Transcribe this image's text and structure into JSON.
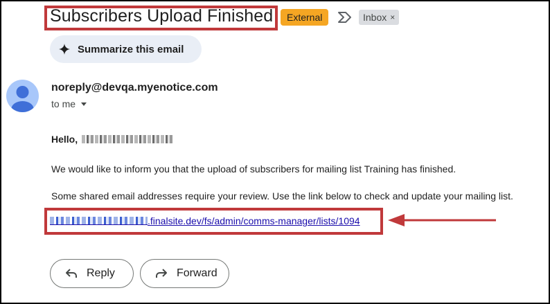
{
  "subject": "Subscribers Upload Finished",
  "badges": {
    "external": "External",
    "inbox": "Inbox",
    "inbox_close": "×"
  },
  "summarize_label": "Summarize this email",
  "sender": {
    "email": "noreply@devqa.myenotice.com",
    "to_label": "to me"
  },
  "body": {
    "greeting": "Hello,",
    "paragraph1": "We would like to inform you that the upload of subscribers for mailing list Training has finished.",
    "paragraph2": "Some shared email addresses require your review. Use the link below to check and update your mailing list.",
    "link_text": ".finalsite.dev/fs/admin/comms-manager/lists/1094"
  },
  "actions": {
    "reply": "Reply",
    "forward": "Forward"
  },
  "colors": {
    "annotation_red": "#c0393b",
    "external_badge": "#f5a623",
    "link": "#1a0dab",
    "summarize_bg": "#e9eef6",
    "avatar": "#a8c7fa"
  },
  "icons": [
    "sparkle-icon",
    "label-icon",
    "close-icon",
    "avatar-icon",
    "chevron-down-icon",
    "reply-icon",
    "forward-icon",
    "arrow-annotation"
  ]
}
